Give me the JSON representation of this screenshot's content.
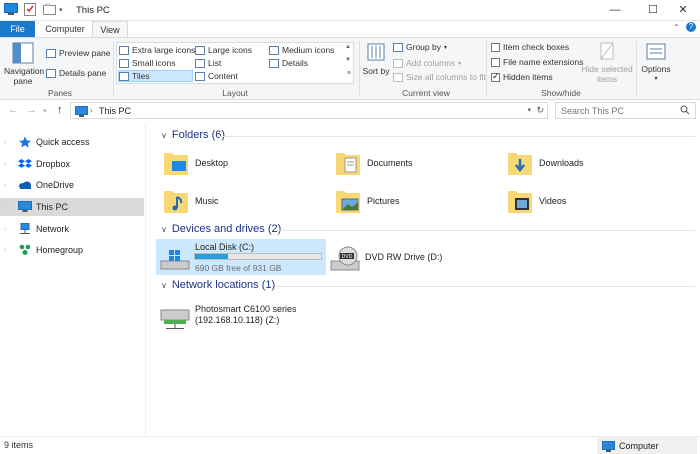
{
  "window": {
    "title": "This PC",
    "controls": {
      "minimize": "—",
      "maximize": "☐",
      "close": "✕"
    }
  },
  "ribbon_tabs": [
    {
      "label": "File"
    },
    {
      "label": "Computer"
    },
    {
      "label": "View"
    }
  ],
  "ribbon": {
    "panes": {
      "group_label": "Panes",
      "navigation_pane": "Navigation pane",
      "preview_pane": "Preview pane",
      "details_pane": "Details pane"
    },
    "layout": {
      "group_label": "Layout",
      "options": [
        {
          "label": "Extra large icons"
        },
        {
          "label": "Large icons"
        },
        {
          "label": "Medium icons"
        },
        {
          "label": "Small icons"
        },
        {
          "label": "List"
        },
        {
          "label": "Details"
        },
        {
          "label": "Tiles",
          "selected": true
        },
        {
          "label": "Content"
        }
      ]
    },
    "current_view": {
      "group_label": "Current view",
      "sort_by": "Sort by",
      "group_by": "Group by",
      "add_columns": "Add columns",
      "size_all_columns": "Size all columns to fit"
    },
    "show_hide": {
      "group_label": "Show/hide",
      "item_check_boxes": {
        "label": "Item check boxes",
        "checked": false
      },
      "file_name_extensions": {
        "label": "File name extensions",
        "checked": false
      },
      "hidden_items": {
        "label": "Hidden items",
        "checked": true
      },
      "hide_selected_items": "Hide selected items"
    },
    "options": {
      "label": "Options"
    }
  },
  "address": {
    "path": "This PC",
    "search_placeholder": "Search This PC"
  },
  "sidebar": {
    "items": [
      {
        "label": "Quick access",
        "icon": "star-icon",
        "color": "#1e78d2"
      },
      {
        "label": "Dropbox",
        "icon": "dropbox-icon",
        "color": "#0061fe"
      },
      {
        "label": "OneDrive",
        "icon": "cloud-icon",
        "color": "#0f5fb5"
      },
      {
        "label": "This PC",
        "icon": "computer-icon",
        "selected": true,
        "color": "#2b88d8"
      },
      {
        "label": "Network",
        "icon": "network-icon",
        "color": "#2b88d8"
      },
      {
        "label": "Homegroup",
        "icon": "homegroup-icon",
        "color": "#1c9e5a"
      }
    ]
  },
  "sections": {
    "folders": {
      "heading": "Folders (6)",
      "items": [
        {
          "label": "Desktop",
          "icon": "desktop-folder-icon"
        },
        {
          "label": "Documents",
          "icon": "documents-folder-icon"
        },
        {
          "label": "Downloads",
          "icon": "downloads-folder-icon"
        },
        {
          "label": "Music",
          "icon": "music-folder-icon"
        },
        {
          "label": "Pictures",
          "icon": "pictures-folder-icon"
        },
        {
          "label": "Videos",
          "icon": "videos-folder-icon"
        }
      ]
    },
    "devices": {
      "heading": "Devices and drives (2)",
      "local_disk": {
        "name": "Local Disk (C:)",
        "free_text": "690 GB free of 931 GB",
        "used_fraction": 0.26
      },
      "dvd": {
        "name": "DVD RW Drive (D:)"
      }
    },
    "network": {
      "heading": "Network locations (1)",
      "item": {
        "name": "Photosmart C6100 series",
        "sub": "(192.168.10.118) (Z:)"
      }
    }
  },
  "status": {
    "item_count": "9 items",
    "location": "Computer"
  },
  "colors": {
    "accent": "#1979ca",
    "heading": "#1e3287",
    "selection": "#cce8ff",
    "folder": "#f8d775",
    "drive_bar": "#26a0da"
  }
}
